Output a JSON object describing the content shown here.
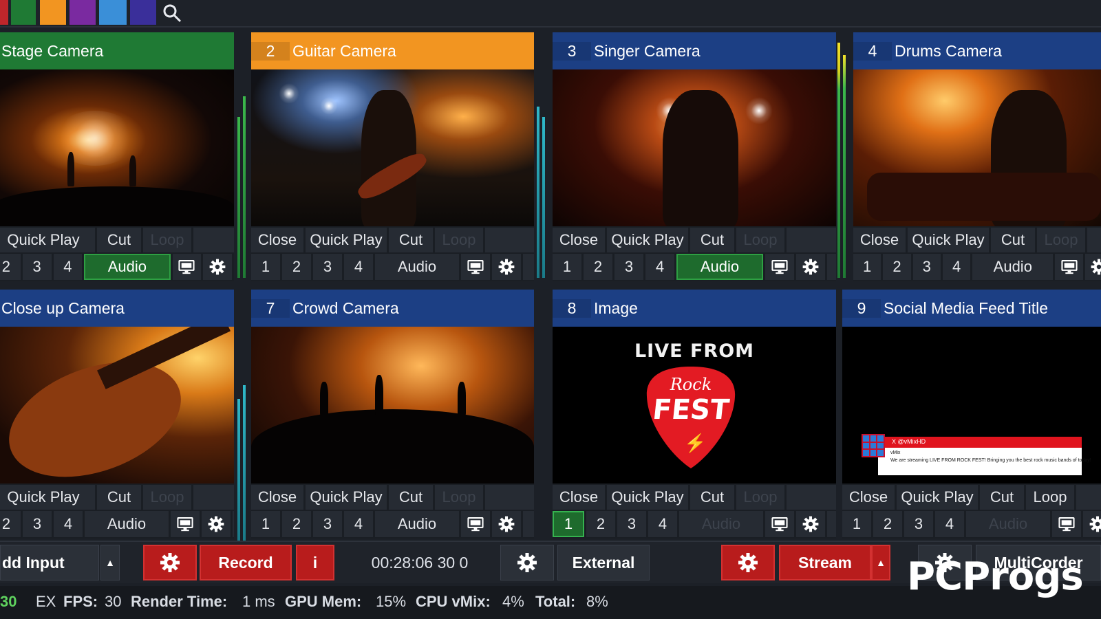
{
  "top_bar": {
    "swatches": [
      {
        "name": "red",
        "color": "#c0262b"
      },
      {
        "name": "green",
        "color": "#1f7a34"
      },
      {
        "name": "orange",
        "color": "#f29521"
      },
      {
        "name": "purple",
        "color": "#7a2aa0"
      },
      {
        "name": "light-blue",
        "color": "#3a8fd8"
      },
      {
        "name": "indigo",
        "color": "#3a2f9a"
      }
    ],
    "search_icon": "search-icon"
  },
  "inputs": [
    {
      "number": "",
      "title": "Stage Camera",
      "header_color": "#1f7a34",
      "preview": "stage",
      "row1": [
        "Quick Play",
        "Cut",
        "Loop"
      ],
      "row2_nums": [
        "2",
        "3",
        "4"
      ],
      "audio": "Audio",
      "audio_active": true,
      "active_num": ""
    },
    {
      "number": "2",
      "title": "Guitar Camera",
      "header_color": "#f29521",
      "preview": "guitar",
      "row1": [
        "Close",
        "Quick Play",
        "Cut",
        "Loop"
      ],
      "row2_nums": [
        "1",
        "2",
        "3",
        "4"
      ],
      "audio": "Audio",
      "audio_active": false,
      "active_num": ""
    },
    {
      "number": "3",
      "title": "Singer Camera",
      "header_color": "#1c3f84",
      "preview": "singer",
      "row1": [
        "Close",
        "Quick Play",
        "Cut",
        "Loop"
      ],
      "row2_nums": [
        "1",
        "2",
        "3",
        "4"
      ],
      "audio": "Audio",
      "audio_active": true,
      "active_num": ""
    },
    {
      "number": "4",
      "title": "Drums Camera",
      "header_color": "#1c3f84",
      "preview": "drums",
      "row1": [
        "Close",
        "Quick Play",
        "Cut",
        "Loop"
      ],
      "row2_nums": [
        "1",
        "2",
        "3",
        "4"
      ],
      "audio": "Audio",
      "audio_active": false,
      "active_num": ""
    },
    {
      "number": "",
      "title": "Close up Camera",
      "header_color": "#1c3f84",
      "preview": "closeup",
      "row1": [
        "Quick Play",
        "Cut",
        "Loop"
      ],
      "row2_nums": [
        "2",
        "3",
        "4"
      ],
      "audio": "Audio",
      "audio_active": false,
      "active_num": ""
    },
    {
      "number": "7",
      "title": "Crowd Camera",
      "header_color": "#1c3f84",
      "preview": "crowd",
      "row1": [
        "Close",
        "Quick Play",
        "Cut",
        "Loop"
      ],
      "row2_nums": [
        "1",
        "2",
        "3",
        "4"
      ],
      "audio": "Audio",
      "audio_active": false,
      "active_num": ""
    },
    {
      "number": "8",
      "title": "Image",
      "header_color": "#1c3f84",
      "preview": "image",
      "row1": [
        "Close",
        "Quick Play",
        "Cut",
        "Loop"
      ],
      "row2_nums": [
        "1",
        "2",
        "3",
        "4"
      ],
      "audio": "Audio",
      "audio_active": false,
      "audio_dim": true,
      "active_num": "1"
    },
    {
      "number": "9",
      "title": "Social Media Feed Title",
      "header_color": "#1c3f84",
      "preview": "social",
      "row1": [
        "Close",
        "Quick Play",
        "Cut",
        "Loop"
      ],
      "row2_nums": [
        "1",
        "2",
        "3",
        "4"
      ],
      "audio": "Audio",
      "audio_active": false,
      "audio_dim": true,
      "loop_active": true,
      "active_num": ""
    }
  ],
  "image_preview": {
    "headline": "LIVE FROM",
    "rock": "Rock",
    "fest": "FEST"
  },
  "social_preview": {
    "handle": "X @vMixHD",
    "name": "vMix",
    "message": "We are streaming LIVE FROM ROCK FEST! Bringing you the best rock music bands of today!"
  },
  "toolbar": {
    "add_input": "dd Input",
    "record": "Record",
    "info": "i",
    "timecode": "00:28:06 30 0",
    "external": "External",
    "stream": "Stream",
    "multicorder": "MultiCorder"
  },
  "status": {
    "left_value": "30",
    "ex": "EX",
    "fps_label": "FPS:",
    "fps_value": "30",
    "render_label": "Render Time:",
    "render_value": "1 ms",
    "gpu_label": "GPU Mem:",
    "gpu_value": "15%",
    "cpu_label": "CPU vMix:",
    "cpu_value": "4%",
    "total_label": "Total:",
    "total_value": "8%"
  },
  "watermark": "PCProgs",
  "colors": {
    "accent_red": "#b81c1c",
    "accent_green": "#1e6b2d",
    "header_blue": "#1c3f84"
  }
}
